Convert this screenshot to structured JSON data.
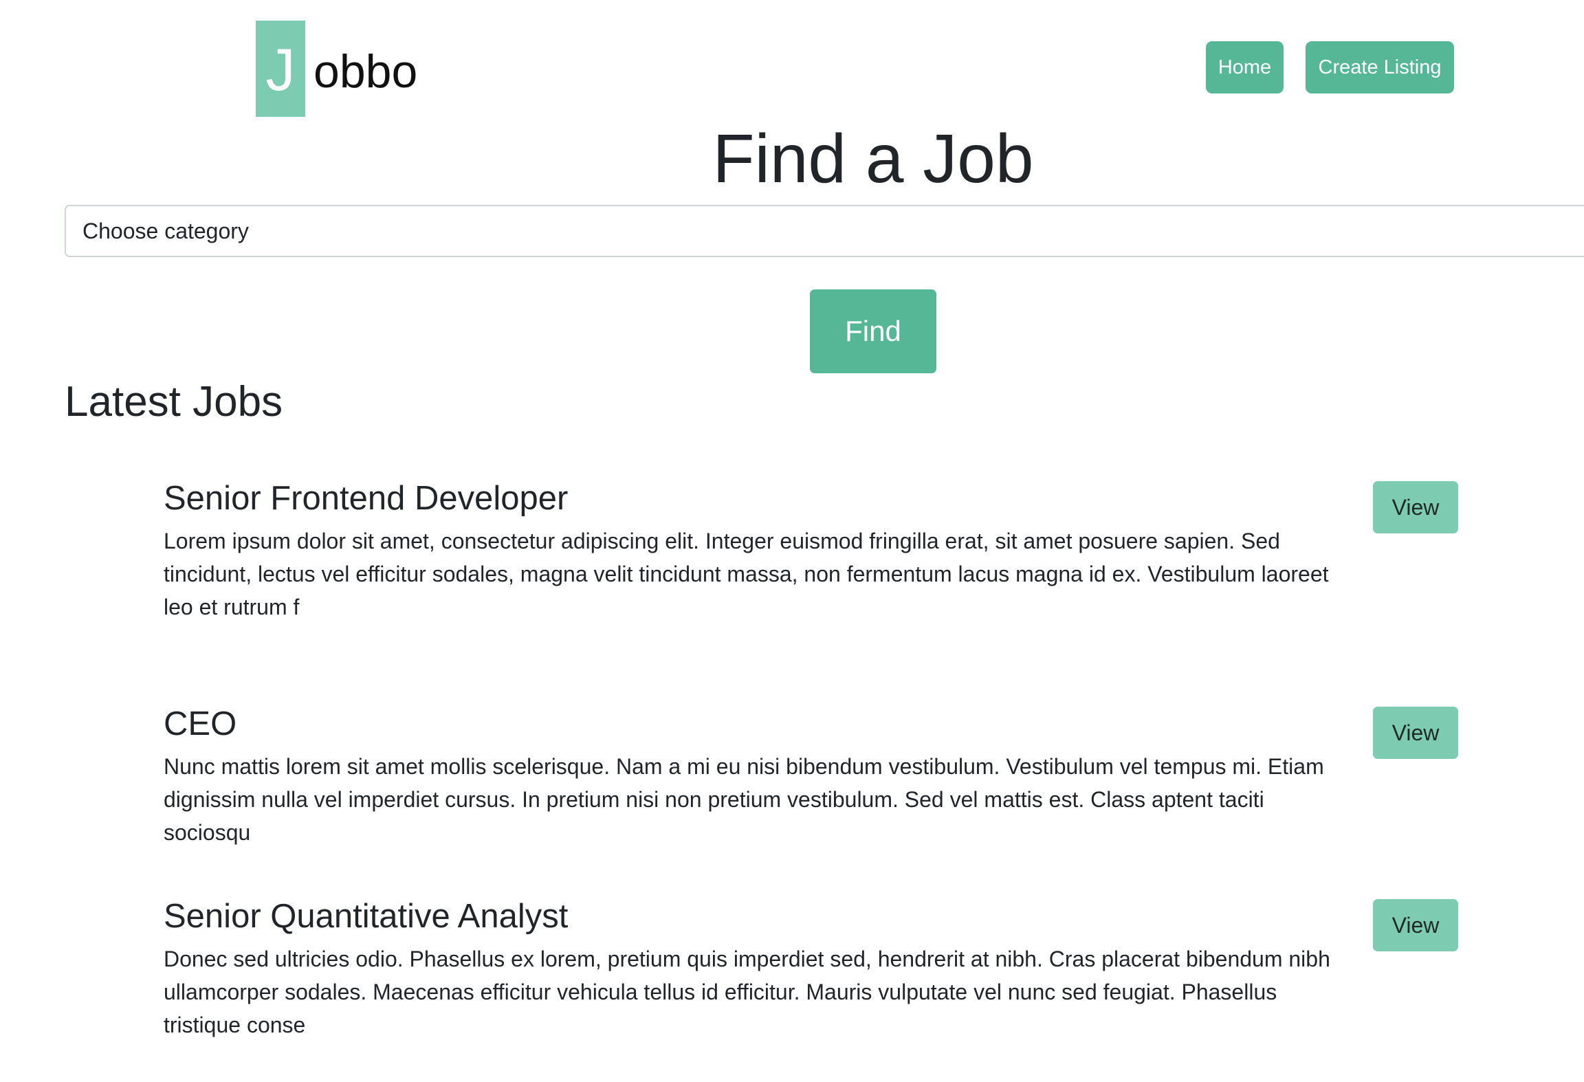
{
  "brand": {
    "logo_letter": "J",
    "logo_rest": "obbo",
    "accent_color": "#55b795",
    "logo_color": "#7dcbb0"
  },
  "nav": {
    "home_label": "Home",
    "create_listing_label": "Create Listing"
  },
  "page_title": "Find a Job",
  "search": {
    "category_value": "Choose category",
    "find_label": "Find"
  },
  "latest": {
    "title": "Latest Jobs",
    "jobs": [
      {
        "title": "Senior Frontend Developer",
        "description": "Lorem ipsum dolor sit amet, consectetur adipiscing elit. Integer euismod fringilla erat, sit amet posuere sapien. Sed tincidunt, lectus vel efficitur sodales, magna velit tincidunt massa, non fermentum lacus magna id ex. Vestibulum laoreet leo et rutrum f",
        "view_label": "View"
      },
      {
        "title": "CEO",
        "description": "Nunc mattis lorem sit amet mollis scelerisque. Nam a mi eu nisi bibendum vestibulum. Vestibulum vel tempus mi. Etiam dignissim nulla vel imperdiet cursus. In pretium nisi non pretium vestibulum. Sed vel mattis est. Class aptent taciti sociosqu",
        "view_label": "View"
      },
      {
        "title": "Senior Quantitative Analyst",
        "description": "Donec sed ultricies odio. Phasellus ex lorem, pretium quis imperdiet sed, hendrerit at nibh. Cras placerat bibendum nibh ullamcorper sodales. Maecenas efficitur vehicula tellus id efficitur. Mauris vulputate vel nunc sed feugiat. Phasellus tristique conse",
        "view_label": "View"
      }
    ]
  }
}
